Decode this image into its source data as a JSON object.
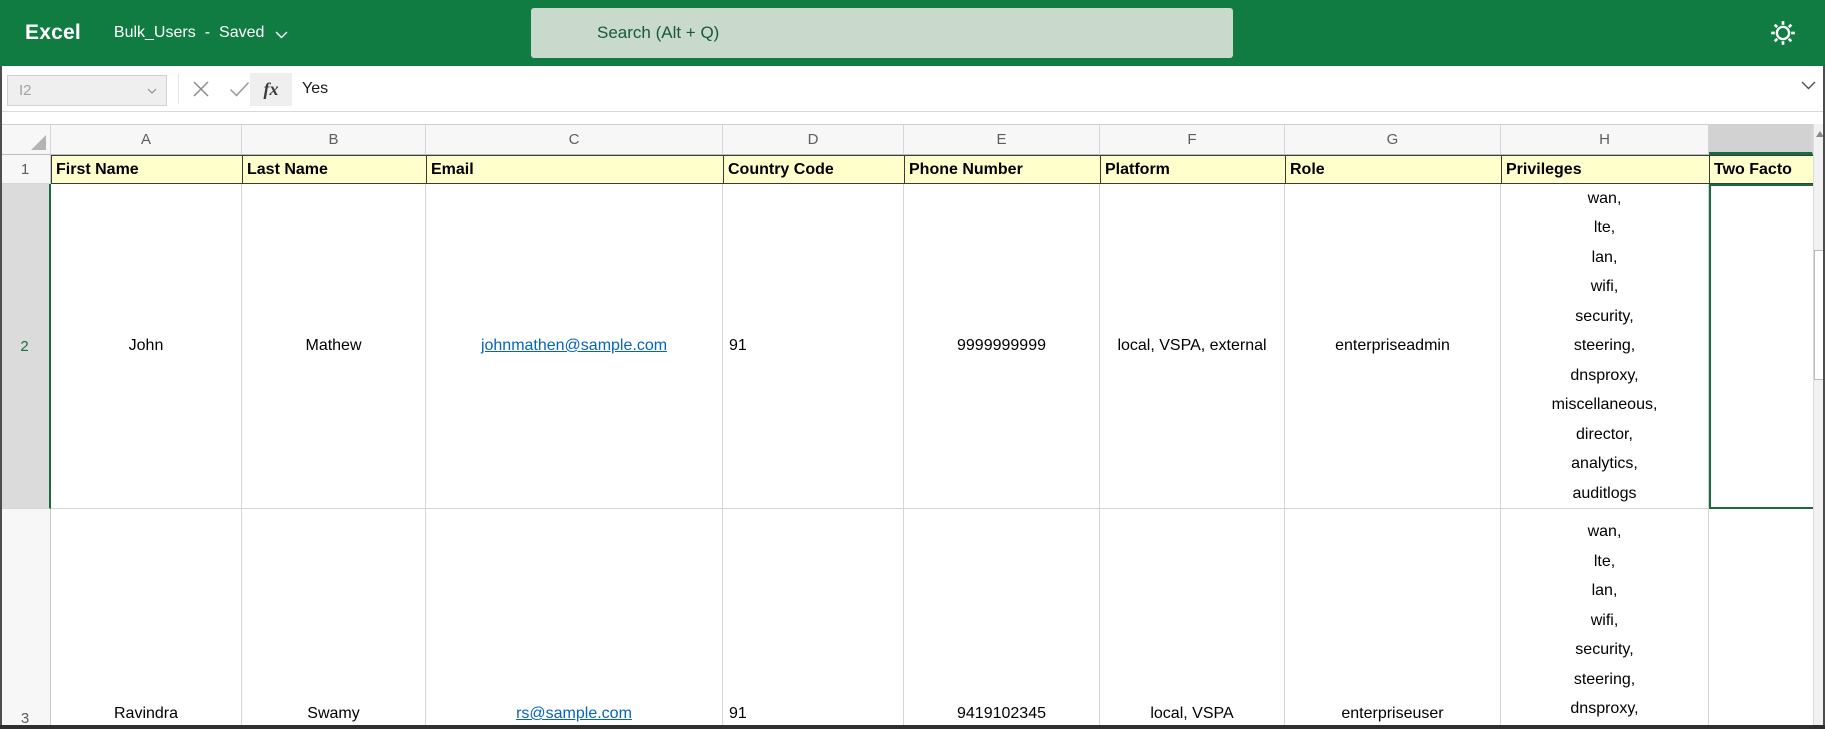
{
  "topbar": {
    "app_name": "Excel",
    "doc_title": "Bulk_Users",
    "title_separator": "-",
    "doc_status": "Saved",
    "search_placeholder": "Search (Alt + Q)"
  },
  "formula_bar": {
    "cell_reference": "I2",
    "fx_label": "fx",
    "formula_value": "Yes"
  },
  "sheet": {
    "column_letters": [
      "A",
      "B",
      "C",
      "D",
      "E",
      "F",
      "G",
      "H"
    ],
    "row_numbers": [
      "1",
      "2",
      "3"
    ],
    "headers": [
      "First Name",
      "Last Name",
      "Email",
      "Country Code",
      "Phone Number",
      "Platform",
      "Role",
      "Privileges",
      "Two Facto"
    ],
    "rows": [
      {
        "first_name": "John",
        "last_name": "Mathew",
        "email": "johnmathen@sample.com",
        "country_code": "91",
        "phone_number": "9999999999",
        "platform": "local, VSPA, external",
        "role": "enterpriseadmin",
        "privileges": [
          "wan,",
          "lte,",
          "lan,",
          "wifi,",
          "security,",
          "steering,",
          "dnsproxy,",
          "miscellaneous,",
          "director,",
          "analytics,",
          "auditlogs"
        ]
      },
      {
        "first_name": "Ravindra",
        "last_name": "Swamy",
        "email": "rs@sample.com",
        "country_code": "91",
        "phone_number": "9419102345",
        "platform": "local, VSPA",
        "role": "enterpriseuser",
        "privileges": [
          "wan,",
          "lte,",
          "lan,",
          "wifi,",
          "security,",
          "steering,",
          "dnsproxy,"
        ]
      }
    ]
  },
  "icons": {
    "gear": "⚙",
    "chevron_down": "⌄",
    "cancel": "✕",
    "enter": "✓",
    "select_all_corner": "◢",
    "scroll_up": "▲"
  },
  "colors": {
    "brand_green": "#107c41",
    "search_box_bg": "#c9dacd",
    "search_text_green": "#175b36",
    "header_row_yellow": "#ffffcc",
    "selection_green": "#1a6b40",
    "link_blue": "#0563c1",
    "grid_line": "#d6d6d6"
  }
}
